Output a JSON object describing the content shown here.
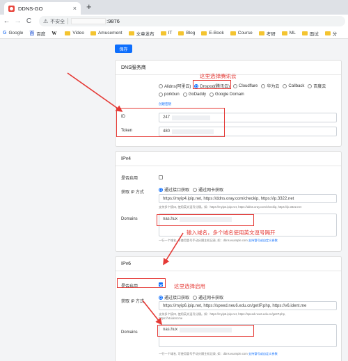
{
  "browser": {
    "tab_title": "DDNS-GO",
    "tab_close": "×",
    "new_tab": "+",
    "nav_back": "←",
    "nav_forward": "→",
    "nav_reload": "C",
    "warn_icon": "⚠",
    "insecure_label": "不安全",
    "url_port": ":9876",
    "bookmarks": [
      {
        "icon": "G",
        "label": "Google"
      },
      {
        "icon": "百",
        "label": "百度"
      },
      {
        "icon": "W",
        "label": ""
      },
      {
        "icon": "folder",
        "label": "Video"
      },
      {
        "icon": "folder",
        "label": "Amusement"
      },
      {
        "icon": "folder",
        "label": "文章发布"
      },
      {
        "icon": "folder",
        "label": "IT"
      },
      {
        "icon": "folder",
        "label": "Blog"
      },
      {
        "icon": "folder",
        "label": "E-Book"
      },
      {
        "icon": "folder",
        "label": "Course"
      },
      {
        "icon": "folder",
        "label": "考研"
      },
      {
        "icon": "folder",
        "label": "ML"
      },
      {
        "icon": "folder",
        "label": "面试"
      },
      {
        "icon": "folder",
        "label": "分"
      }
    ]
  },
  "page": {
    "save_label": "保存",
    "dns": {
      "title": "DNS服务商",
      "providers_row1": [
        {
          "label": "Alidns(阿里云)",
          "selected": false
        },
        {
          "label": "Dnspod(腾讯云)",
          "selected": true
        },
        {
          "label": "Cloudflare",
          "selected": false
        },
        {
          "label": "华为云",
          "selected": false
        },
        {
          "label": "Callback",
          "selected": false
        },
        {
          "label": "百度云",
          "selected": false
        }
      ],
      "providers_row2": [
        {
          "label": "porkbun",
          "selected": false
        },
        {
          "label": "GoDaddy",
          "selected": false
        },
        {
          "label": "Google Domain",
          "selected": false
        }
      ],
      "create_link": "创建密钥",
      "id_label": "ID",
      "id_value": "247",
      "token_label": "Token",
      "token_value": "480"
    },
    "ipv4": {
      "title": "IPv4",
      "enable_label": "是否启用",
      "enabled": false,
      "method_label": "获取 IP 方式",
      "method_options": [
        {
          "label": "通过接口获取",
          "selected": true
        },
        {
          "label": "通过网卡获取",
          "selected": false
        }
      ],
      "urls_value": "https://myip4.ipip.net, https://ddns.oray.com/checkip, https://ip.3322.net",
      "urls_help": "支持多个接口, 使用英文逗号分隔。如：https://myip4.ipip.net, https://ddns.oray.com/checkip, https://ip.3322.net",
      "domains_label": "Domains",
      "domains_value": "nas.hux",
      "domains_help": "一行一个域名, 可使用冒号手动分隔主机记录, 如：ddns.example.com",
      "domains_help_link": "支持冒号或自定义参数"
    },
    "ipv6": {
      "title": "IPv6",
      "enable_label": "是否启用",
      "enabled": true,
      "method_label": "获取 IP 方式",
      "method_options": [
        {
          "label": "通过接口获取",
          "selected": true
        },
        {
          "label": "通过网卡获取",
          "selected": false
        }
      ],
      "urls_value": "https://myip6.ipip.net, https://speed.neu6.edu.cn/getIP.php, https://v6.ident.me",
      "urls_help_line1": "支持多个接口, 使用英文逗号分隔。如：https://myip6.ipip.net, https://speed.neu6.edu.cn/getIP.php,",
      "urls_help_line2": "https://v6.ident.me",
      "domains_label": "Domains",
      "domains_value": "nas.hux",
      "domains_help": "一行一个域名, 可使用冒号手动分隔主机记录, 如：ddns.example.com",
      "domains_help_link": "支持冒号或自定义参数"
    }
  },
  "annotations": {
    "choose_tencent": "这里选择腾讯云",
    "enter_domain": "输入域名，多个域名使用英文逗号隔开",
    "choose_enable": "这里选择启用",
    "color": "#e53935"
  }
}
